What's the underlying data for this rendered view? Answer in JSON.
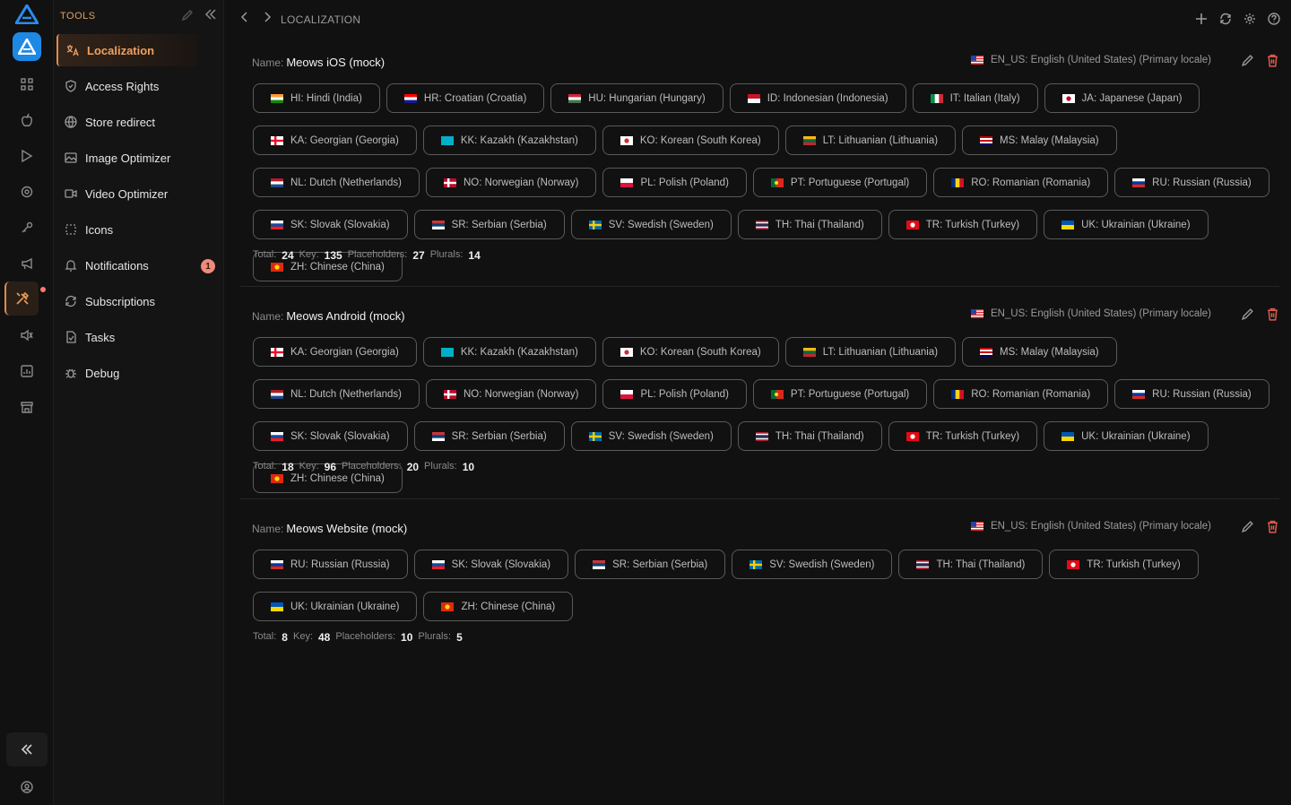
{
  "sidebar": {
    "title": "TOOLS",
    "items": [
      {
        "label": "Localization",
        "icon": "translate-icon"
      },
      {
        "label": "Access Rights",
        "icon": "shield-icon"
      },
      {
        "label": "Store redirect",
        "icon": "globe-icon"
      },
      {
        "label": "Image Optimizer",
        "icon": "image-icon"
      },
      {
        "label": "Video Optimizer",
        "icon": "video-icon"
      },
      {
        "label": "Icons",
        "icon": "icons-grid-icon"
      },
      {
        "label": "Notifications",
        "icon": "bell-icon"
      },
      {
        "label": "Subscriptions",
        "icon": "refresh-icon"
      },
      {
        "label": "Tasks",
        "icon": "task-icon"
      },
      {
        "label": "Debug",
        "icon": "bug-icon"
      }
    ],
    "notification_badge": "1"
  },
  "header": {
    "breadcrumb": "LOCALIZATION"
  },
  "projects": [
    {
      "name_label": "Name:",
      "name": "Meows iOS (mock)",
      "primary_locale": "EN_US: English (United States) (Primary locale)",
      "locales": [
        {
          "label": "HI: Hindi (India)",
          "flag": "in"
        },
        {
          "label": "HR: Croatian (Croatia)",
          "flag": "hr"
        },
        {
          "label": "HU: Hungarian (Hungary)",
          "flag": "hu"
        },
        {
          "label": "ID: Indonesian (Indonesia)",
          "flag": "id"
        },
        {
          "label": "IT: Italian (Italy)",
          "flag": "it"
        },
        {
          "label": "JA: Japanese (Japan)",
          "flag": "jp"
        },
        {
          "label": "KA: Georgian (Georgia)",
          "flag": "ge"
        },
        {
          "label": "KK: Kazakh (Kazakhstan)",
          "flag": "kz"
        },
        {
          "label": "KO: Korean (South Korea)",
          "flag": "kr"
        },
        {
          "label": "LT: Lithuanian (Lithuania)",
          "flag": "lt"
        },
        {
          "label": "MS: Malay (Malaysia)",
          "flag": "my"
        },
        {
          "label": "NL: Dutch (Netherlands)",
          "flag": "nl"
        },
        {
          "label": "NO: Norwegian (Norway)",
          "flag": "no"
        },
        {
          "label": "PL: Polish (Poland)",
          "flag": "pl"
        },
        {
          "label": "PT: Portuguese (Portugal)",
          "flag": "pt"
        },
        {
          "label": "RO: Romanian (Romania)",
          "flag": "ro"
        },
        {
          "label": "RU: Russian (Russia)",
          "flag": "ru"
        },
        {
          "label": "SK: Slovak (Slovakia)",
          "flag": "sk"
        },
        {
          "label": "SR: Serbian (Serbia)",
          "flag": "rs"
        },
        {
          "label": "SV: Swedish (Sweden)",
          "flag": "se"
        },
        {
          "label": "TH: Thai (Thailand)",
          "flag": "th"
        },
        {
          "label": "TR: Turkish (Turkey)",
          "flag": "tr"
        },
        {
          "label": "UK: Ukrainian (Ukraine)",
          "flag": "ua"
        },
        {
          "label": "ZH: Chinese (China)",
          "flag": "cn"
        }
      ],
      "stats": {
        "total_label": "Total:",
        "total": "24",
        "key_label": "Key:",
        "key": "135",
        "placeholders_label": "Placeholders:",
        "placeholders": "27",
        "plurals_label": "Plurals:",
        "plurals": "14"
      }
    },
    {
      "name_label": "Name:",
      "name": "Meows Android (mock)",
      "primary_locale": "EN_US: English (United States) (Primary locale)",
      "locales": [
        {
          "label": "KA: Georgian (Georgia)",
          "flag": "ge"
        },
        {
          "label": "KK: Kazakh (Kazakhstan)",
          "flag": "kz"
        },
        {
          "label": "KO: Korean (South Korea)",
          "flag": "kr"
        },
        {
          "label": "LT: Lithuanian (Lithuania)",
          "flag": "lt"
        },
        {
          "label": "MS: Malay (Malaysia)",
          "flag": "my"
        },
        {
          "label": "NL: Dutch (Netherlands)",
          "flag": "nl"
        },
        {
          "label": "NO: Norwegian (Norway)",
          "flag": "no"
        },
        {
          "label": "PL: Polish (Poland)",
          "flag": "pl"
        },
        {
          "label": "PT: Portuguese (Portugal)",
          "flag": "pt"
        },
        {
          "label": "RO: Romanian (Romania)",
          "flag": "ro"
        },
        {
          "label": "RU: Russian (Russia)",
          "flag": "ru"
        },
        {
          "label": "SK: Slovak (Slovakia)",
          "flag": "sk"
        },
        {
          "label": "SR: Serbian (Serbia)",
          "flag": "rs"
        },
        {
          "label": "SV: Swedish (Sweden)",
          "flag": "se"
        },
        {
          "label": "TH: Thai (Thailand)",
          "flag": "th"
        },
        {
          "label": "TR: Turkish (Turkey)",
          "flag": "tr"
        },
        {
          "label": "UK: Ukrainian (Ukraine)",
          "flag": "ua"
        },
        {
          "label": "ZH: Chinese (China)",
          "flag": "cn"
        }
      ],
      "stats": {
        "total_label": "Total:",
        "total": "18",
        "key_label": "Key:",
        "key": "96",
        "placeholders_label": "Placeholders:",
        "placeholders": "20",
        "plurals_label": "Plurals:",
        "plurals": "10"
      }
    },
    {
      "name_label": "Name:",
      "name": "Meows Website (mock)",
      "primary_locale": "EN_US: English (United States) (Primary locale)",
      "locales": [
        {
          "label": "RU: Russian (Russia)",
          "flag": "ru"
        },
        {
          "label": "SK: Slovak (Slovakia)",
          "flag": "sk"
        },
        {
          "label": "SR: Serbian (Serbia)",
          "flag": "rs"
        },
        {
          "label": "SV: Swedish (Sweden)",
          "flag": "se"
        },
        {
          "label": "TH: Thai (Thailand)",
          "flag": "th"
        },
        {
          "label": "TR: Turkish (Turkey)",
          "flag": "tr"
        },
        {
          "label": "UK: Ukrainian (Ukraine)",
          "flag": "ua"
        },
        {
          "label": "ZH: Chinese (China)",
          "flag": "cn"
        }
      ],
      "stats": {
        "total_label": "Total:",
        "total": "8",
        "key_label": "Key:",
        "key": "48",
        "placeholders_label": "Placeholders:",
        "placeholders": "10",
        "plurals_label": "Plurals:",
        "plurals": "5"
      }
    }
  ],
  "colors": {
    "accent": "#e08a4a",
    "app_blue": "#1e88e5",
    "badge": "#f08a7a",
    "delete": "#e05a4a"
  }
}
